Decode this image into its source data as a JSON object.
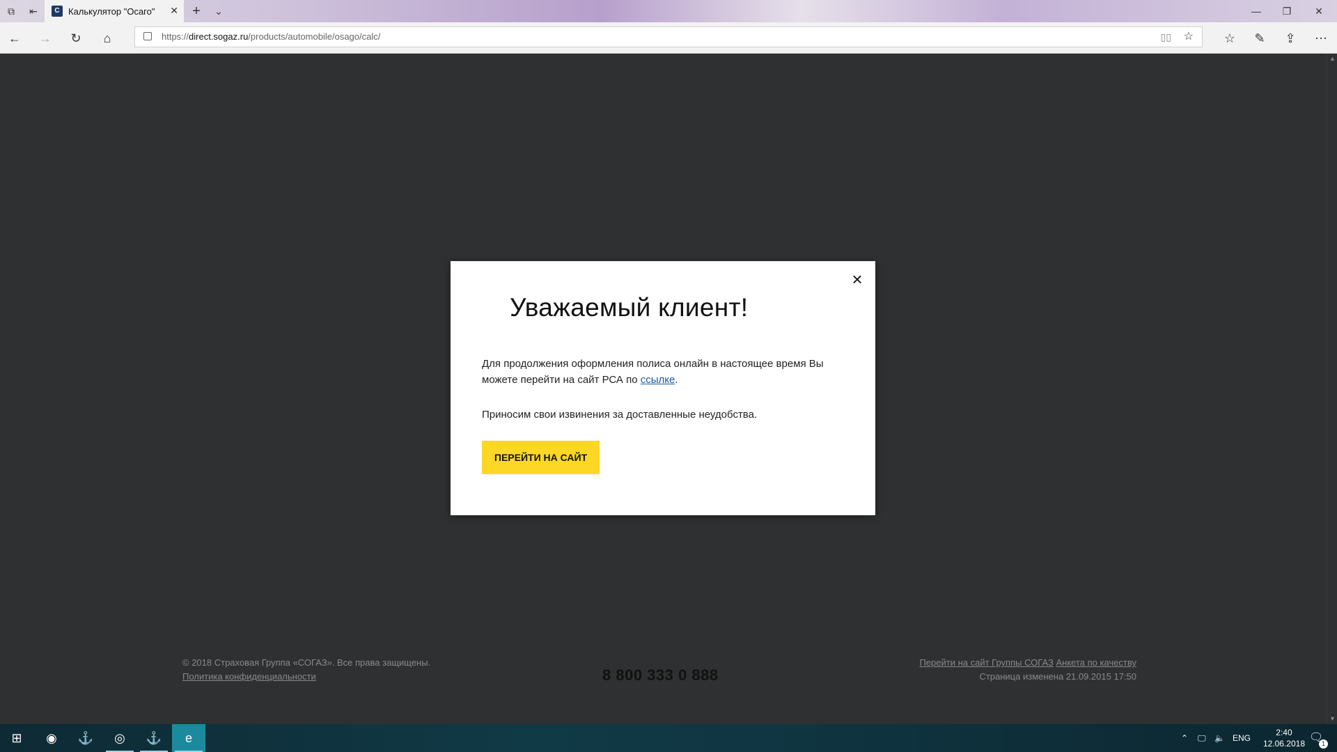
{
  "browser": {
    "tab_title": "Калькулятор \"Осаго\"",
    "url_prefix": "https://",
    "url_domain": "direct.sogaz.ru",
    "url_path": "/products/automobile/osago/calc/"
  },
  "modal": {
    "title": "Уважаемый клиент!",
    "text1_before_link": "Для продолжения оформления полиса онлайн в настоящее время Вы можете перейти на сайт РСА по ",
    "link_text": "ссылке",
    "text1_after_link": ".",
    "text2": "Приносим свои извинения за доставленные неудобства.",
    "button_label": "ПЕРЕЙТИ НА САЙТ"
  },
  "footer": {
    "copyright": "© 2018 Страховая Группа «СОГАЗ». Все права защищены.",
    "privacy_link": "Политика конфиденциальности",
    "phone": "8 800 333 0 888",
    "group_link": "Перейти на сайт Группы СОГАЗ",
    "quality_link": "Анкета по качеству",
    "modified": "Страница изменена 21.09.2015 17:50"
  },
  "taskbar": {
    "language": "ENG",
    "time": "2:40",
    "date": "12.06.2018",
    "notification_count": "1"
  },
  "colors": {
    "accent_button": "#fcd825",
    "page_background": "#2f3031",
    "link": "#1a5aa0"
  }
}
